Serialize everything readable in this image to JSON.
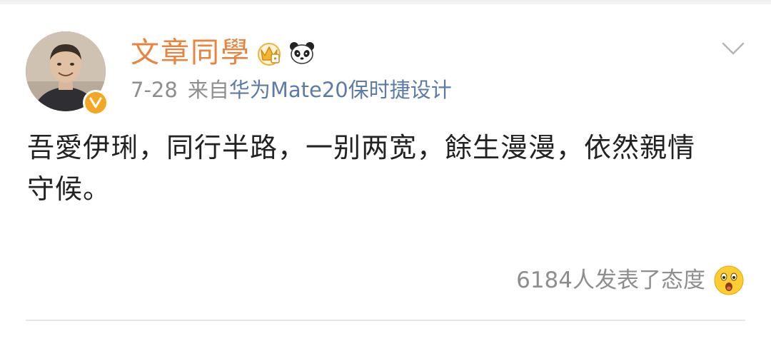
{
  "post": {
    "author": {
      "name": "文章同學",
      "avatar_icon": "user-avatar",
      "verified_icon": "verified-v-icon",
      "badges": [
        "crown-badge-icon",
        "panda-badge-icon"
      ]
    },
    "meta": {
      "date": "7-28",
      "source_prefix": "来自",
      "source_device": "华为Mate20保时捷设计"
    },
    "text_line1": "吾愛伊琍，同行半路，一别两宽，餘生漫漫，依然親情",
    "text_line2": "守候。",
    "reactions": {
      "count_text": "6184人发表了态度",
      "emoji_icon": "surprised-face-icon"
    },
    "menu_icon": "chevron-down-icon"
  },
  "colors": {
    "username": "#e8843f",
    "source_link": "#5b7ca8",
    "meta_gray": "#8e8e8e",
    "body_text": "#222222",
    "verified_badge": "#f5a623"
  }
}
